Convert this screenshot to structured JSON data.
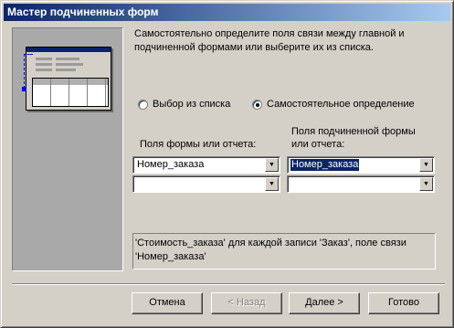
{
  "window": {
    "title": "Мастер подчиненных форм"
  },
  "instructions": "Самостоятельно определите поля связи между главной и подчиненной формами или выберите их из списка.",
  "radio": {
    "from_list": {
      "label": "Выбор из списка",
      "checked": false
    },
    "manual": {
      "label": "Самостоятельное определение",
      "checked": true
    }
  },
  "columns": {
    "main_label": "Поля формы или отчета:",
    "sub_label": "Поля подчиненной формы или отчета:"
  },
  "fields": {
    "main_1": "Номер_заказа",
    "main_2": "",
    "sub_1": "Номер_заказа",
    "sub_2": ""
  },
  "info_text": "'Стоимость_заказа' для каждой записи 'Заказ', поле связи 'Номер_заказа'",
  "buttons": {
    "cancel": "Отмена",
    "back": "< Назад",
    "next": "Далее >",
    "finish": "Готово"
  }
}
